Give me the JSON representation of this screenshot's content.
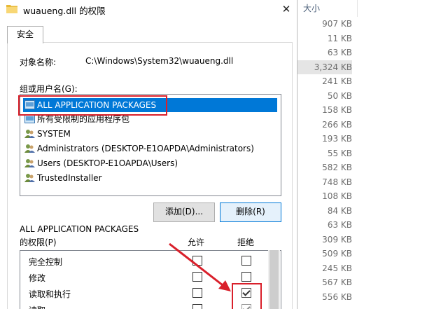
{
  "window": {
    "title": "wuaueng.dll 的权限",
    "close_glyph": "✕"
  },
  "tab": {
    "label": "安全"
  },
  "object": {
    "label": "对象名称:",
    "value": "C:\\Windows\\System32\\wuaueng.dll"
  },
  "groups": {
    "label": "组或用户名(G):",
    "items": [
      {
        "name": "ALL APPLICATION PACKAGES",
        "selected": true,
        "icon": "package-group-icon"
      },
      {
        "name": "所有受限制的应用程序包",
        "selected": false,
        "icon": "package-group-icon"
      },
      {
        "name": "SYSTEM",
        "selected": false,
        "icon": "users-icon"
      },
      {
        "name": "Administrators (DESKTOP-E1OAPDA\\Administrators)",
        "selected": false,
        "icon": "users-icon"
      },
      {
        "name": "Users (DESKTOP-E1OAPDA\\Users)",
        "selected": false,
        "icon": "users-icon"
      },
      {
        "name": "TrustedInstaller",
        "selected": false,
        "icon": "users-icon"
      }
    ]
  },
  "buttons": {
    "add": "添加(D)...",
    "remove": "删除(R)"
  },
  "permissions": {
    "title_line1": "ALL APPLICATION PACKAGES",
    "title_line2": "的权限(P)",
    "allow_header": "允许",
    "deny_header": "拒绝",
    "rows": [
      {
        "name": "完全控制",
        "allow": false,
        "deny": false
      },
      {
        "name": "修改",
        "allow": false,
        "deny": false
      },
      {
        "name": "读取和执行",
        "allow": false,
        "deny": true
      },
      {
        "name": "读取",
        "allow": false,
        "deny": true
      }
    ]
  },
  "file_sizes": {
    "header": "大小",
    "values": [
      "907 KB",
      "11 KB",
      "63 KB",
      "3,324 KB",
      "241 KB",
      "50 KB",
      "158 KB",
      "266 KB",
      "193 KB",
      "55 KB",
      "582 KB",
      "748 KB",
      "108 KB",
      "84 KB",
      "63 KB",
      "309 KB",
      "509 KB",
      "245 KB",
      "567 KB",
      "556 KB"
    ],
    "highlighted_index": 3
  },
  "colors": {
    "selection": "#0078d7",
    "annotation_red": "#d9202b"
  }
}
